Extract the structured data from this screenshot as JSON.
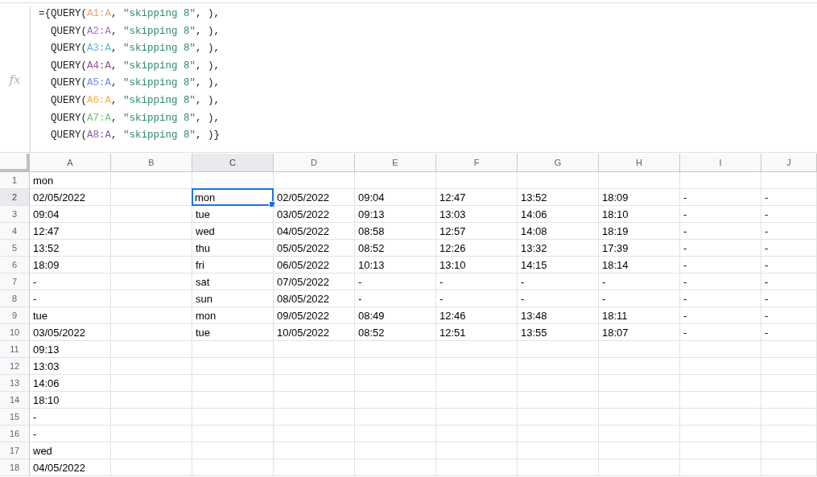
{
  "formula_bar": {
    "label": "fx",
    "lines": [
      [
        {
          "kind": "plain",
          "text": "={QUERY("
        },
        {
          "kind": "ref",
          "text": "A1:A",
          "color": "#f2a36b"
        },
        {
          "kind": "plain",
          "text": ", "
        },
        {
          "kind": "string",
          "text": "\"skipping 8\""
        },
        {
          "kind": "plain",
          "text": ", ),"
        }
      ],
      [
        {
          "kind": "plain",
          "text": "  QUERY("
        },
        {
          "kind": "ref",
          "text": "A2:A",
          "color": "#a570c4"
        },
        {
          "kind": "plain",
          "text": ", "
        },
        {
          "kind": "string",
          "text": "\"skipping 8\""
        },
        {
          "kind": "plain",
          "text": ", ),"
        }
      ],
      [
        {
          "kind": "plain",
          "text": "  QUERY("
        },
        {
          "kind": "ref",
          "text": "A3:A",
          "color": "#5db7d8"
        },
        {
          "kind": "plain",
          "text": ", "
        },
        {
          "kind": "string",
          "text": "\"skipping 8\""
        },
        {
          "kind": "plain",
          "text": ", ),"
        }
      ],
      [
        {
          "kind": "plain",
          "text": "  QUERY("
        },
        {
          "kind": "ref",
          "text": "A4:A",
          "color": "#9c4f8d"
        },
        {
          "kind": "plain",
          "text": ", "
        },
        {
          "kind": "string",
          "text": "\"skipping 8\""
        },
        {
          "kind": "plain",
          "text": ", ),"
        }
      ],
      [
        {
          "kind": "plain",
          "text": "  QUERY("
        },
        {
          "kind": "ref",
          "text": "A5:A",
          "color": "#7687ef"
        },
        {
          "kind": "plain",
          "text": ", "
        },
        {
          "kind": "string",
          "text": "\"skipping 8\""
        },
        {
          "kind": "plain",
          "text": ", ),"
        }
      ],
      [
        {
          "kind": "plain",
          "text": "  QUERY("
        },
        {
          "kind": "ref",
          "text": "A6:A",
          "color": "#f5ad4c"
        },
        {
          "kind": "plain",
          "text": ", "
        },
        {
          "kind": "string",
          "text": "\"skipping 8\""
        },
        {
          "kind": "plain",
          "text": ", ),"
        }
      ],
      [
        {
          "kind": "plain",
          "text": "  QUERY("
        },
        {
          "kind": "ref",
          "text": "A7:A",
          "color": "#7cc47a"
        },
        {
          "kind": "plain",
          "text": ", "
        },
        {
          "kind": "string",
          "text": "\"skipping 8\""
        },
        {
          "kind": "plain",
          "text": ", ),"
        }
      ],
      [
        {
          "kind": "plain",
          "text": "  QUERY("
        },
        {
          "kind": "ref",
          "text": "A8:A",
          "color": "#8a5fae"
        },
        {
          "kind": "plain",
          "text": ", "
        },
        {
          "kind": "string",
          "text": "\"skipping 8\""
        },
        {
          "kind": "plain",
          "text": ", )}"
        }
      ]
    ]
  },
  "columns": [
    "A",
    "B",
    "C",
    "D",
    "E",
    "F",
    "G",
    "H",
    "I",
    "J"
  ],
  "rows": [
    {
      "number": "1",
      "cells": {
        "A": {
          "text": "mon",
          "selected": false
        }
      }
    },
    {
      "number": "2",
      "cells": {
        "A": {
          "text": "02/05/2022",
          "selected": false
        },
        "C": {
          "text": "mon",
          "selected": true
        },
        "D": {
          "text": "02/05/2022",
          "selected": false
        },
        "E": {
          "text": "09:04",
          "selected": false
        },
        "F": {
          "text": "12:47",
          "selected": false
        },
        "G": {
          "text": "13:52",
          "selected": false
        },
        "H": {
          "text": "18:09",
          "selected": false
        },
        "I": {
          "text": "-",
          "selected": false
        },
        "J": {
          "text": "-",
          "selected": false
        }
      }
    },
    {
      "number": "3",
      "cells": {
        "A": {
          "text": "09:04",
          "selected": false
        },
        "C": {
          "text": "tue",
          "selected": false
        },
        "D": {
          "text": "03/05/2022",
          "selected": false
        },
        "E": {
          "text": "09:13",
          "selected": false
        },
        "F": {
          "text": "13:03",
          "selected": false
        },
        "G": {
          "text": "14:06",
          "selected": false
        },
        "H": {
          "text": "18:10",
          "selected": false
        },
        "I": {
          "text": "-",
          "selected": false
        },
        "J": {
          "text": "-",
          "selected": false
        }
      }
    },
    {
      "number": "4",
      "cells": {
        "A": {
          "text": "12:47",
          "selected": false
        },
        "C": {
          "text": "wed",
          "selected": false
        },
        "D": {
          "text": "04/05/2022",
          "selected": false
        },
        "E": {
          "text": "08:58",
          "selected": false
        },
        "F": {
          "text": "12:57",
          "selected": false
        },
        "G": {
          "text": "14:08",
          "selected": false
        },
        "H": {
          "text": "18:19",
          "selected": false
        },
        "I": {
          "text": "-",
          "selected": false
        },
        "J": {
          "text": "-",
          "selected": false
        }
      }
    },
    {
      "number": "5",
      "cells": {
        "A": {
          "text": "13:52",
          "selected": false
        },
        "C": {
          "text": "thu",
          "selected": false
        },
        "D": {
          "text": "05/05/2022",
          "selected": false
        },
        "E": {
          "text": "08:52",
          "selected": false
        },
        "F": {
          "text": "12:26",
          "selected": false
        },
        "G": {
          "text": "13:32",
          "selected": false
        },
        "H": {
          "text": "17:39",
          "selected": false
        },
        "I": {
          "text": "-",
          "selected": false
        },
        "J": {
          "text": "-",
          "selected": false
        }
      }
    },
    {
      "number": "6",
      "cells": {
        "A": {
          "text": "18:09",
          "selected": false
        },
        "C": {
          "text": "fri",
          "selected": false
        },
        "D": {
          "text": "06/05/2022",
          "selected": false
        },
        "E": {
          "text": "10:13",
          "selected": false
        },
        "F": {
          "text": "13:10",
          "selected": false
        },
        "G": {
          "text": "14:15",
          "selected": false
        },
        "H": {
          "text": "18:14",
          "selected": false
        },
        "I": {
          "text": "-",
          "selected": false
        },
        "J": {
          "text": "-",
          "selected": false
        }
      }
    },
    {
      "number": "7",
      "cells": {
        "A": {
          "text": "-",
          "selected": false
        },
        "C": {
          "text": "sat",
          "selected": false
        },
        "D": {
          "text": "07/05/2022",
          "selected": false
        },
        "E": {
          "text": "-",
          "selected": false
        },
        "F": {
          "text": "-",
          "selected": false
        },
        "G": {
          "text": "-",
          "selected": false
        },
        "H": {
          "text": "-",
          "selected": false
        },
        "I": {
          "text": "-",
          "selected": false
        },
        "J": {
          "text": "-",
          "selected": false
        }
      }
    },
    {
      "number": "8",
      "cells": {
        "A": {
          "text": "-",
          "selected": false
        },
        "C": {
          "text": "sun",
          "selected": false
        },
        "D": {
          "text": "08/05/2022",
          "selected": false
        },
        "E": {
          "text": "-",
          "selected": false
        },
        "F": {
          "text": "-",
          "selected": false
        },
        "G": {
          "text": "-",
          "selected": false
        },
        "H": {
          "text": "-",
          "selected": false
        },
        "I": {
          "text": "-",
          "selected": false
        },
        "J": {
          "text": "-",
          "selected": false
        }
      }
    },
    {
      "number": "9",
      "cells": {
        "A": {
          "text": "tue",
          "selected": false
        },
        "C": {
          "text": "mon",
          "selected": false
        },
        "D": {
          "text": "09/05/2022",
          "selected": false
        },
        "E": {
          "text": "08:49",
          "selected": false
        },
        "F": {
          "text": "12:46",
          "selected": false
        },
        "G": {
          "text": "13:48",
          "selected": false
        },
        "H": {
          "text": "18:11",
          "selected": false
        },
        "I": {
          "text": "-",
          "selected": false
        },
        "J": {
          "text": "-",
          "selected": false
        }
      }
    },
    {
      "number": "10",
      "cells": {
        "A": {
          "text": "03/05/2022",
          "selected": false
        },
        "C": {
          "text": "tue",
          "selected": false
        },
        "D": {
          "text": "10/05/2022",
          "selected": false
        },
        "E": {
          "text": "08:52",
          "selected": false
        },
        "F": {
          "text": "12:51",
          "selected": false
        },
        "G": {
          "text": "13:55",
          "selected": false
        },
        "H": {
          "text": "18:07",
          "selected": false
        },
        "I": {
          "text": "-",
          "selected": false
        },
        "J": {
          "text": "-",
          "selected": false
        }
      }
    },
    {
      "number": "11",
      "cells": {
        "A": {
          "text": "09:13",
          "selected": false
        }
      }
    },
    {
      "number": "12",
      "cells": {
        "A": {
          "text": "13:03",
          "selected": false
        }
      }
    },
    {
      "number": "13",
      "cells": {
        "A": {
          "text": "14:06",
          "selected": false
        }
      }
    },
    {
      "number": "14",
      "cells": {
        "A": {
          "text": "18:10",
          "selected": false
        }
      }
    },
    {
      "number": "15",
      "cells": {
        "A": {
          "text": "-",
          "selected": false
        }
      }
    },
    {
      "number": "16",
      "cells": {
        "A": {
          "text": "-",
          "selected": false
        }
      }
    },
    {
      "number": "17",
      "cells": {
        "A": {
          "text": "wed",
          "selected": false
        }
      }
    },
    {
      "number": "18",
      "cells": {
        "A": {
          "text": "04/05/2022",
          "selected": false
        }
      }
    }
  ]
}
